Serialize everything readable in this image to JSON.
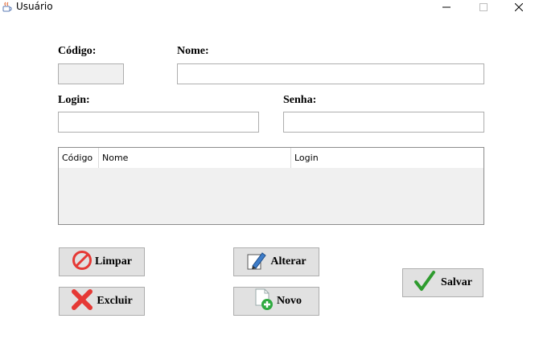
{
  "window": {
    "title": "Usuário",
    "minimize_glyph": "—",
    "maximize_glyph": "☐",
    "close_glyph": "✕"
  },
  "form": {
    "codigo_label": "Código:",
    "codigo_value": "",
    "nome_label": "Nome:",
    "nome_value": "",
    "login_label": "Login:",
    "login_value": "",
    "senha_label": "Senha:",
    "senha_value": ""
  },
  "table": {
    "columns": [
      "Código",
      "Nome",
      "Login"
    ],
    "rows": []
  },
  "buttons": {
    "limpar": "Limpar",
    "excluir": "Excluir",
    "alterar": "Alterar",
    "novo": "Novo",
    "salvar": "Salvar"
  },
  "icons": {
    "app": "java-coffee-icon",
    "limpar": "no-entry-icon",
    "excluir": "red-x-icon",
    "alterar": "edit-pencil-icon",
    "novo": "new-document-icon",
    "salvar": "green-checkmark-icon"
  },
  "colors": {
    "button_face": "#e1e1e1",
    "disabled_field": "#f0f0f0",
    "danger_red": "#e53935",
    "success_green": "#2e9b2e"
  }
}
